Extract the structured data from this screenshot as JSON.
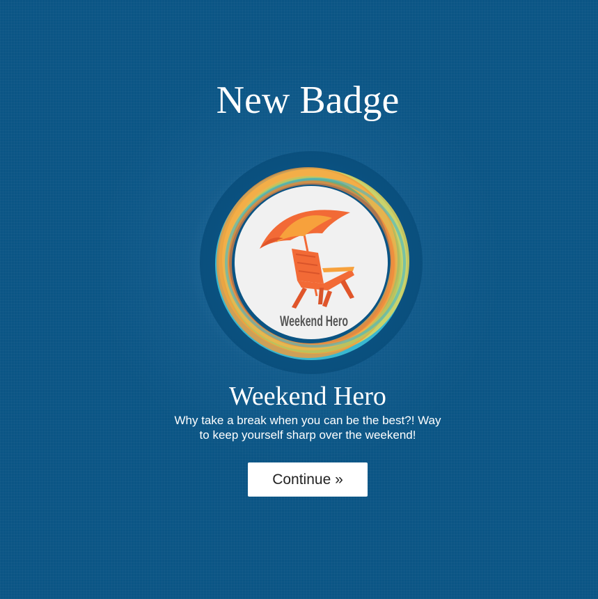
{
  "heading": "New Badge",
  "badge": {
    "name": "Weekend Hero",
    "label": "Weekend Hero",
    "description": "Why take a break when you can be the best?! Way to keep yourself sharp over the weekend!",
    "icon": "beach-chair-umbrella-icon"
  },
  "actions": {
    "continue_label": "Continue »"
  },
  "colors": {
    "background": "#0b5585",
    "accent_orange": "#f26a36",
    "ring_yellow": "#e3d75a",
    "ring_cyan": "#3ec3d8",
    "button_bg": "#ffffff"
  }
}
